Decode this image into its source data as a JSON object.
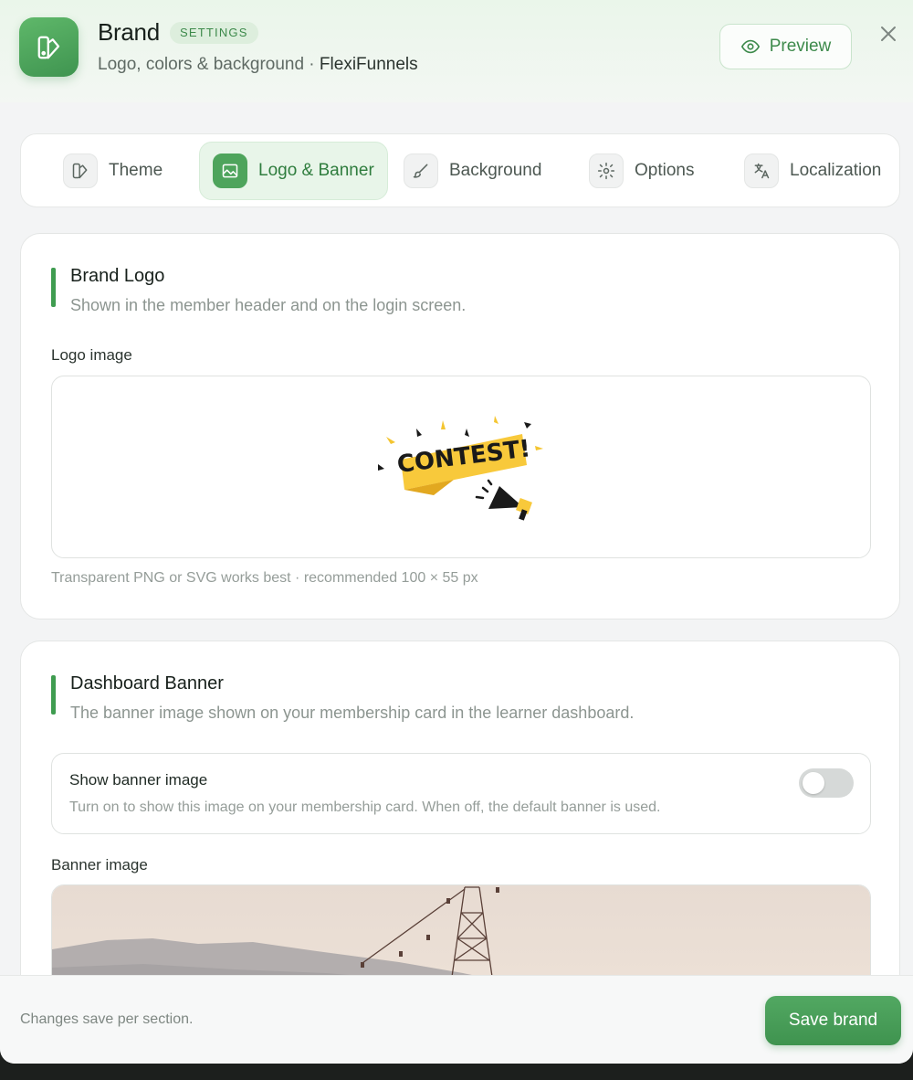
{
  "header": {
    "title": "Brand",
    "badge": "SETTINGS",
    "subtitle_prefix": "Logo, colors & background · ",
    "subtitle_brand": "FlexiFunnels",
    "preview_label": "Preview"
  },
  "tabs": [
    {
      "label": "Theme",
      "icon": "theme-icon",
      "active": false
    },
    {
      "label": "Logo & Banner",
      "icon": "image-icon",
      "active": true
    },
    {
      "label": "Background",
      "icon": "brush-icon",
      "active": false
    },
    {
      "label": "Options",
      "icon": "gear-icon",
      "active": false
    },
    {
      "label": "Localization",
      "icon": "translate-icon",
      "active": false
    }
  ],
  "logo_section": {
    "title": "Brand Logo",
    "description": "Shown in the member header and on the login screen.",
    "field_label": "Logo image",
    "logo_text": "CONTEST!",
    "hint": "Transparent PNG or SVG works best · recommended 100 × 55 px"
  },
  "banner_section": {
    "title": "Dashboard Banner",
    "description": "The banner image shown on your membership card in the learner dashboard.",
    "toggle_title": "Show banner image",
    "toggle_description": "Turn on to show this image on your membership card. When off, the default banner is used.",
    "toggle_on": false,
    "field_label": "Banner image"
  },
  "footer": {
    "note": "Changes save per section.",
    "save_label": "Save brand"
  },
  "colors": {
    "accent": "#3f9c50",
    "accent_light": "#e8f5e9"
  }
}
